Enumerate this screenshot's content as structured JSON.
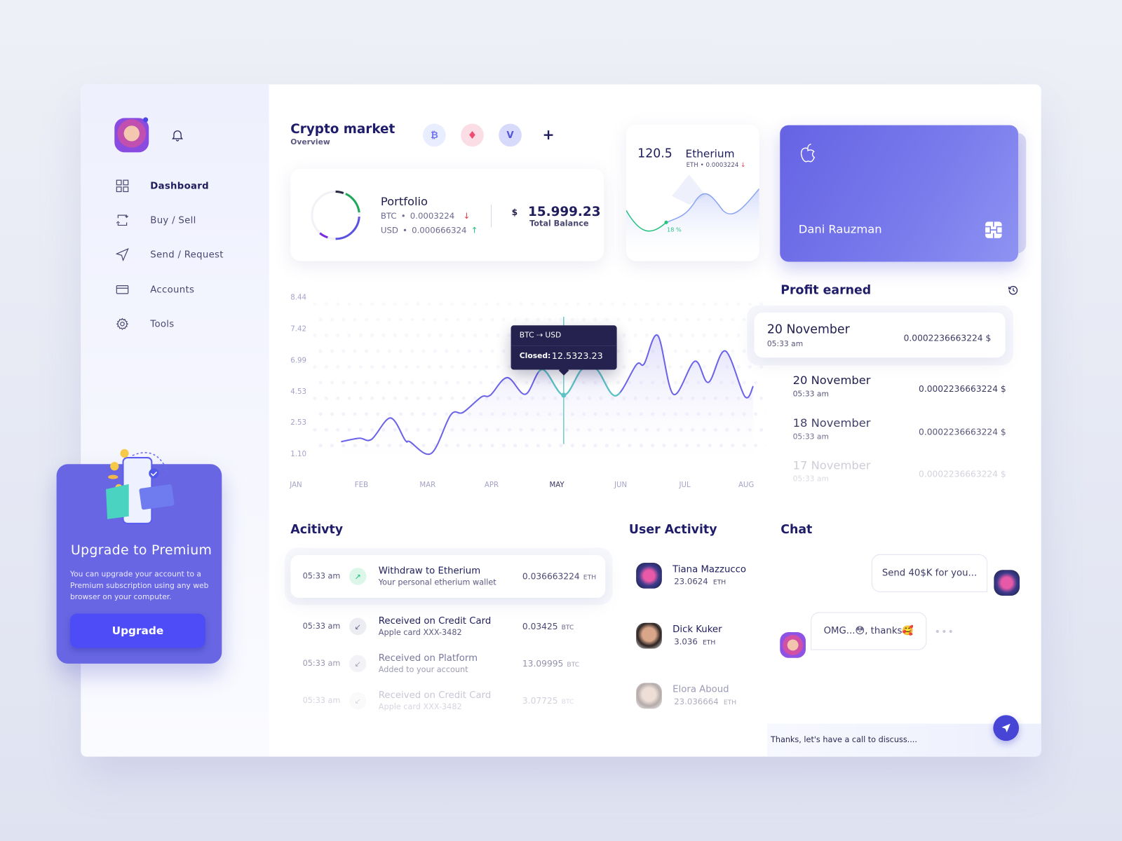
{
  "sidebar": {
    "nav": [
      {
        "label": "Dashboard",
        "icon": "grid-icon",
        "active": true
      },
      {
        "label": "Buy / Sell",
        "icon": "exchange-icon"
      },
      {
        "label": "Send / Request",
        "icon": "send-icon"
      },
      {
        "label": "Accounts",
        "icon": "card-icon"
      },
      {
        "label": "Tools",
        "icon": "gear-icon"
      }
    ],
    "upgrade": {
      "title": "Upgrade to Premium",
      "text": "You can upgrade your account to a Premium subscription using any web browser on your computer.",
      "button": "Upgrade"
    }
  },
  "market": {
    "title": "Crypto market",
    "subtitle": "Overview",
    "coins": [
      "bitcoin-icon",
      "ethereum-icon",
      "vechain-icon"
    ],
    "add": "+"
  },
  "portfolio": {
    "title": "Portfolio",
    "btc_label": "BTC",
    "btc_value": "0.0003224",
    "usd_label": "USD",
    "usd_value": "0.000666324",
    "currency": "$",
    "balance": "15.999.23",
    "balance_label": "Total Balance",
    "down_color": "#e8334d",
    "up_color": "#26c281"
  },
  "eth_card": {
    "price": "120.5",
    "name": "Etherium",
    "sub": "ETH • 0.0003224",
    "percent": "18 %"
  },
  "credit_card": {
    "holder": "Dani Rauzman",
    "brand_icon": "apple-icon",
    "chip_icon": "chip-icon",
    "color": "#6b68e6"
  },
  "chart_data": {
    "type": "line",
    "xlabels": [
      "JAN",
      "FEB",
      "MAR",
      "APR",
      "MAY",
      "JUN",
      "JUL",
      "AUG"
    ],
    "highlight_x": "MAY",
    "yticks": [
      "1.10",
      "2.53",
      "4.53",
      "6.99",
      "7.42",
      "8.44"
    ],
    "points": [
      [
        0.68,
        1.63
      ],
      [
        0.96,
        1.79
      ],
      [
        1.15,
        1.74
      ],
      [
        1.44,
        2.79
      ],
      [
        1.67,
        1.69
      ],
      [
        1.74,
        1.63
      ],
      [
        2.07,
        1.1
      ],
      [
        2.37,
        2.99
      ],
      [
        2.56,
        3.15
      ],
      [
        2.84,
        4.15
      ],
      [
        2.98,
        4.27
      ],
      [
        3.24,
        5.59
      ],
      [
        3.52,
        4.33
      ],
      [
        3.78,
        6.23
      ],
      [
        4.11,
        4.27
      ],
      [
        4.39,
        6.23
      ],
      [
        4.62,
        6.23
      ],
      [
        4.91,
        4.23
      ],
      [
        5.23,
        6.6
      ],
      [
        5.35,
        6.67
      ],
      [
        5.56,
        7.32
      ],
      [
        5.8,
        4.33
      ],
      [
        6.13,
        6.87
      ],
      [
        6.34,
        5.22
      ],
      [
        6.6,
        7.11
      ],
      [
        6.9,
        4.19
      ],
      [
        7.03,
        4.92
      ]
    ],
    "line_color": "#6c63e8",
    "highlight_color": "#5cc3c3",
    "tooltip": {
      "pair": "BTC ⇢ USD",
      "closed_label": "Closed:",
      "closed_value": "12.5323.23",
      "x": 4.11,
      "y": 4.27
    }
  },
  "profit": {
    "title": "Profit earned",
    "items": [
      {
        "date": "20 November",
        "time": "05:33 am",
        "value": "0.0002236663224 $"
      },
      {
        "date": "20 November",
        "time": "05:33 am",
        "value": "0.0002236663224 $"
      },
      {
        "date": "18 November",
        "time": "05:33 am",
        "value": "0.0002236663224 $"
      },
      {
        "date": "17 November",
        "time": "05:33 am",
        "value": "0.0002236663224 $"
      }
    ]
  },
  "activity": {
    "title": "Acitivty",
    "rows": [
      {
        "time": "05:33 am",
        "title": "Withdraw to Etherium",
        "sub": "Your personal etherium wallet",
        "amount": "0.036663224",
        "cur": "ETH",
        "dir": "up"
      },
      {
        "time": "05:33 am",
        "title": "Received on Credit Card",
        "sub": "Apple card XXX-3482",
        "amount": "0.03425",
        "cur": "BTC",
        "dir": "down"
      },
      {
        "time": "05:33 am",
        "title": "Received on Platform",
        "sub": "Added to your account",
        "amount": "13.09995",
        "cur": "BTC",
        "dir": "down"
      },
      {
        "time": "05:33 am",
        "title": "Received on Credit Card",
        "sub": "Apple card XXX-3482",
        "amount": "3.07725",
        "cur": "BTC",
        "dir": "down"
      }
    ]
  },
  "users": {
    "title": "User Activity",
    "items": [
      {
        "name": "Tiana Mazzucco",
        "amount": "23.0624",
        "cur": "ETH"
      },
      {
        "name": "Dick Kuker",
        "amount": "3.036",
        "cur": "ETH"
      },
      {
        "name": "Elora Aboud",
        "amount": "23.036664",
        "cur": "ETH"
      }
    ]
  },
  "chat": {
    "title": "Chat",
    "messages": [
      {
        "text": "Send 40$K for you..."
      },
      {
        "text": "OMG...😳, thanks🥰"
      }
    ],
    "input": "Thanks, let's have a call to discuss....",
    "send_icon": "paper-plane-icon"
  }
}
